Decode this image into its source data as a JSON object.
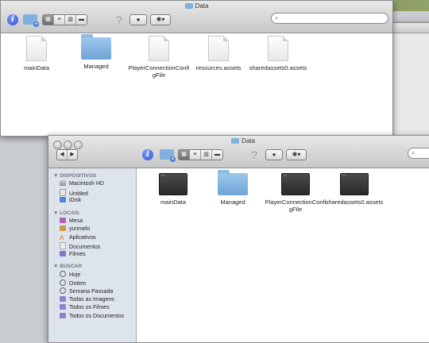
{
  "back_window": {
    "title": "Data",
    "search_placeholder": "",
    "files": [
      {
        "name": "mainData",
        "icon": "document-icon"
      },
      {
        "name": "Managed",
        "icon": "folder-icon"
      },
      {
        "name": "PlayerConnectionConfigFile",
        "icon": "document-icon"
      },
      {
        "name": "resources.assets",
        "icon": "document-icon"
      },
      {
        "name": "sharedassets0.assets",
        "icon": "document-icon"
      }
    ]
  },
  "front_window": {
    "title": "Data",
    "nav": {
      "back": "◀",
      "forward": "▶"
    },
    "toolbar": {
      "help": "?",
      "eye": "👁",
      "action": "✱▾"
    },
    "files": [
      {
        "name": "mainData",
        "icon": "executable-icon"
      },
      {
        "name": "Managed",
        "icon": "folder-icon"
      },
      {
        "name": "PlayerConnectionConfigFile",
        "icon": "executable-icon"
      },
      {
        "name": "sharedassets0.assets",
        "icon": "executable-icon"
      }
    ],
    "sidebar": {
      "devices_header": "DISPOSITIVOS",
      "devices": [
        "Macintosh HD",
        "Untitled",
        "iDisk"
      ],
      "places_header": "LOCAIS",
      "places": [
        "Mesa",
        "yurimelo",
        "Aplicativos",
        "Documentos",
        "Filmes"
      ],
      "search_header": "BUSCAR",
      "search_items": [
        "Hoje",
        "Ontem",
        "Semana Passada",
        "Todas as Imagens",
        "Todos os Filmes",
        "Todos os Documentos"
      ]
    }
  },
  "colors": {
    "info_blue": "#2b4fd1",
    "folder_blue": "#7fb0de",
    "sidebar_bg": "#dee4ec"
  }
}
